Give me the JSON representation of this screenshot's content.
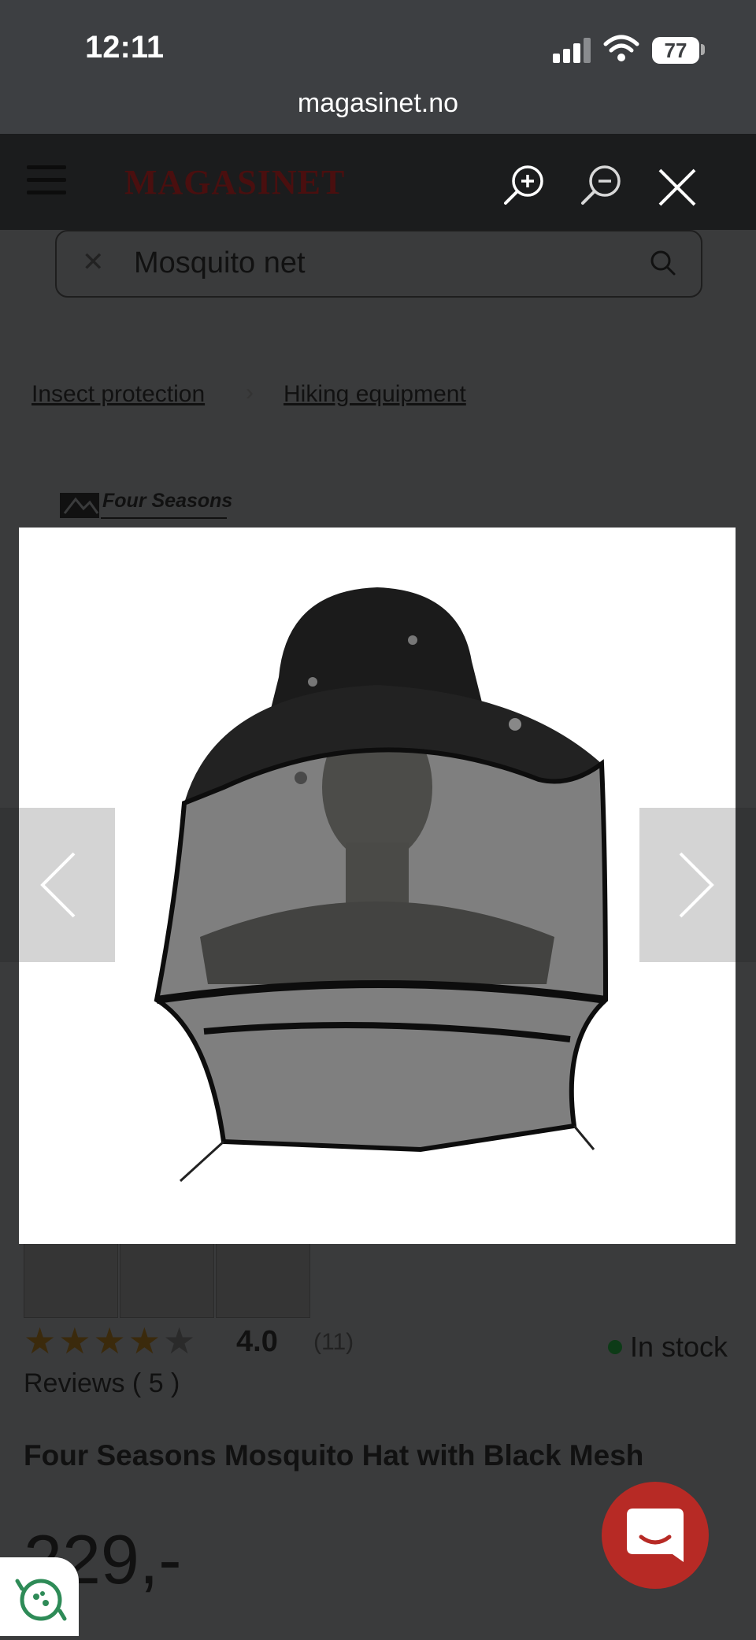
{
  "status_bar": {
    "time": "12:11",
    "battery": "77"
  },
  "browser": {
    "url": "magasinet.no"
  },
  "header": {
    "logo_text": "MAGASINET"
  },
  "search": {
    "value": "Mosquito net",
    "clear_glyph": "✕"
  },
  "breadcrumbs": [
    {
      "label": "Insect protection"
    },
    {
      "label": "Hiking equipment"
    }
  ],
  "breadcrumb_separator": "›",
  "brand": {
    "name": "Four Seasons"
  },
  "product": {
    "rating": "4.0",
    "rating_count": "(11)",
    "stars_filled": 4,
    "stars_total": 5,
    "stock_status": "In stock",
    "reviews_label": "Reviews ( 5 )",
    "title": "Four Seasons Mosquito Hat with Black Mesh",
    "price": "229,-"
  },
  "lightbox": {
    "icons": [
      "zoom-in-icon",
      "zoom-out-icon",
      "close-icon",
      "chevron-left-icon",
      "chevron-right-icon"
    ]
  },
  "colors": {
    "chat_button": "#b72a25",
    "stock_dot": "#0d3b17"
  }
}
